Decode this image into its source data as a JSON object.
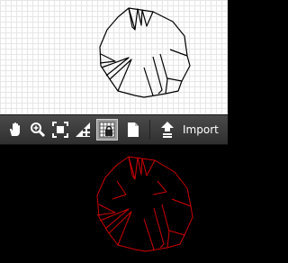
{
  "toolbar": {
    "tools": [
      {
        "id": "pan",
        "icon": "hand-icon"
      },
      {
        "id": "zoom",
        "icon": "magnifier-plus-icon"
      },
      {
        "id": "fit",
        "icon": "fit-to-screen-icon"
      },
      {
        "id": "add-triangle",
        "icon": "triangle-plus-icon"
      },
      {
        "id": "lock-grid",
        "icon": "grid-lock-icon",
        "active": true
      },
      {
        "id": "new-page",
        "icon": "page-icon"
      },
      {
        "id": "import",
        "icon": "upload-arrow-icon"
      }
    ],
    "import_label": "Import"
  },
  "colors": {
    "toolbar_bg": "#3b3b3b",
    "grid_line": "#e6e6e6",
    "shape_top": "#000000",
    "shape_bottom": "#cc0000",
    "bottom_bg": "#000000"
  }
}
